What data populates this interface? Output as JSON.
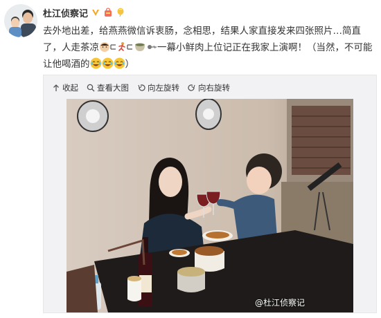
{
  "post": {
    "username": "杜江侦察记",
    "text_line1": "去外地出差，给燕燕微信诉衷肠，念相思，结果人家直接发来四张照片…简直",
    "text_line2a": "了，人走茶凉",
    "text_line2b": "一幕小鲜肉上位记正在我家上演啊！（当然，不可能",
    "text_line3a": "让他喝酒的",
    "text_line3b": "）",
    "badges": [
      "verified-v-icon",
      "vip-bag-icon",
      "balloon-icon"
    ],
    "inline_emojis": [
      "face-emoji",
      "runner-emoji",
      "tea-cup-emoji",
      "pin-emoji"
    ],
    "laugh_emojis": [
      "laugh-cry-emoji",
      "laugh-cry-emoji",
      "laugh-cry-emoji"
    ]
  },
  "toolbar": {
    "collapse": "收起",
    "view_large": "查看大图",
    "rotate_left": "向左旋转",
    "rotate_right": "向右旋转"
  },
  "photo": {
    "watermark": "@杜江侦察记"
  },
  "colors": {
    "verified": "#f5a623",
    "accent_link": "#eb7350",
    "laugh_yellow": "#f7c637"
  }
}
